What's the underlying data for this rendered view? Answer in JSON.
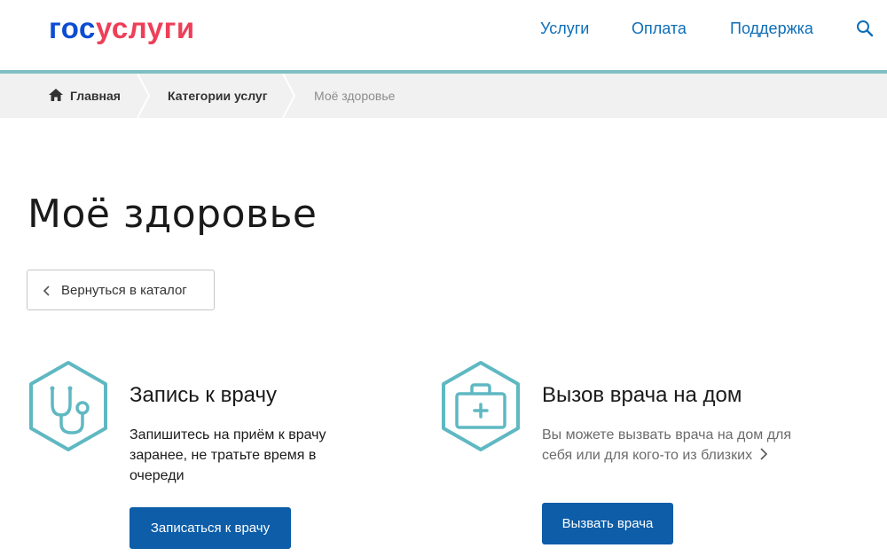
{
  "header": {
    "logo_part1": "гос",
    "logo_part2": "услуги",
    "nav": [
      "Услуги",
      "Оплата",
      "Поддержка"
    ],
    "search_icon": "search-icon"
  },
  "breadcrumb": {
    "home": "Главная",
    "categories": "Категории услуг",
    "current": "Моё здоровье"
  },
  "main": {
    "title": "Моё здоровье",
    "back_button": "Вернуться в каталог",
    "services": [
      {
        "icon": "stethoscope-icon",
        "title": "Запись к врачу",
        "description": "Запишитесь на приём к врачу заранее, не тратьте время в очереди",
        "button": "Записаться к врачу"
      },
      {
        "icon": "medical-kit-icon",
        "title": "Вызов врача на дом",
        "description": "Вы можете вызвать врача на дом для себя или для кого-то из близких",
        "button": "Вызвать врача"
      }
    ]
  },
  "colors": {
    "logo_blue": "#0d4cd3",
    "logo_red": "#ee3f58",
    "nav_link": "#0d6eb8",
    "accent_teal": "#5fb8c2",
    "primary_button": "#0d5da8"
  }
}
